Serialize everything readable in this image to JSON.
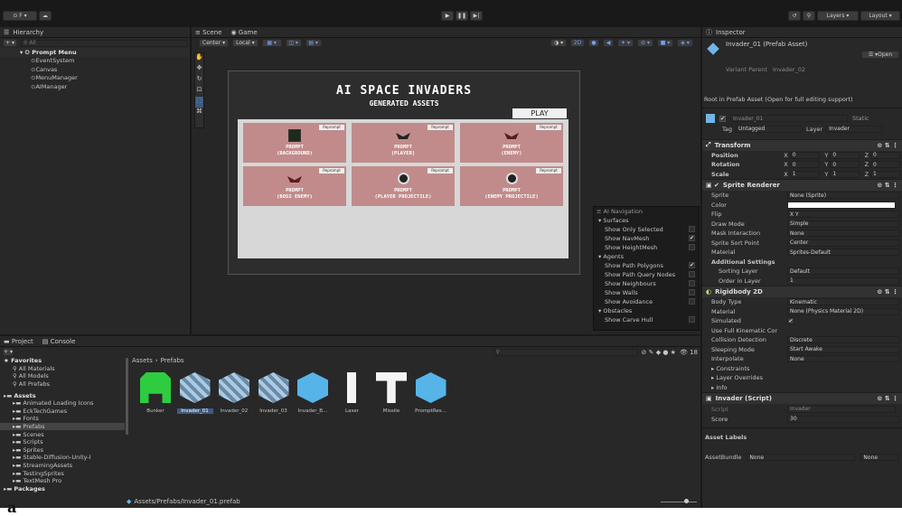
{
  "toolbar": {
    "account_label": "⊙ F ▾",
    "play": "▶",
    "pause": "❚❚",
    "step": "▶|",
    "search": "⚲",
    "layers": "Layers",
    "layout": "Layout"
  },
  "hierarchy": {
    "tab": "Hierarchy",
    "add": "+ ▾",
    "search_placeholder": "All",
    "root": "Prompt Menu",
    "children": [
      "EventSystem",
      "Canvas",
      "MenuManager",
      "AIManager"
    ]
  },
  "scene": {
    "tabs": [
      "Scene",
      "Game"
    ],
    "pivot": "Center ▾",
    "space": "Local ▾",
    "mode2d": "2D"
  },
  "game": {
    "title": "AI SPACE INVADERS",
    "subtitle": "GENERATED ASSETS",
    "play": "PLAY",
    "reprompt": "Reprompt",
    "cards": [
      {
        "line1": "PROMPT",
        "line2": "(BACKGROUND)",
        "icon": "background-thumb"
      },
      {
        "line1": "PROMPT",
        "line2": "(PLAYER)",
        "icon": "player-ship"
      },
      {
        "line1": "PROMPT",
        "line2": "(ENEMY)",
        "icon": "enemy-ship"
      },
      {
        "line1": "PROMPT",
        "line2": "(BOSS ENEMY)",
        "icon": "boss-ship"
      },
      {
        "line1": "PROMPT",
        "line2": "(PLAYER PROJECTILE)",
        "icon": "player-projectile"
      },
      {
        "line1": "PROMPT",
        "line2": "(ENEMY PROJECTILE)",
        "icon": "enemy-projectile"
      }
    ]
  },
  "ainav": {
    "title": "AI Navigation",
    "items": [
      {
        "label": "▾ Surfaces",
        "kind": "header"
      },
      {
        "label": "Show Only Selected",
        "kind": "check",
        "checked": false
      },
      {
        "label": "Show NavMesh",
        "kind": "check",
        "checked": true
      },
      {
        "label": "Show HeightMesh",
        "kind": "check",
        "checked": false
      },
      {
        "label": "▾ Agents",
        "kind": "header"
      },
      {
        "label": "Show Path Polygons",
        "kind": "check",
        "checked": true
      },
      {
        "label": "Show Path Query Nodes",
        "kind": "check",
        "checked": false
      },
      {
        "label": "Show Neighbours",
        "kind": "check",
        "checked": false
      },
      {
        "label": "Show Walls",
        "kind": "check",
        "checked": false
      },
      {
        "label": "Show Avoidance",
        "kind": "check",
        "checked": false
      },
      {
        "label": "▾ Obstacles",
        "kind": "header"
      },
      {
        "label": "Show Carve Hull",
        "kind": "check",
        "checked": false
      }
    ]
  },
  "project": {
    "tabs": [
      "Project",
      "Console"
    ],
    "breadcrumb": [
      "Assets",
      "Prefabs"
    ],
    "count": "18",
    "tree": [
      {
        "label": "★ Favorites",
        "indent": 0,
        "bold": true
      },
      {
        "label": "All Materials",
        "indent": 1,
        "search": true
      },
      {
        "label": "All Models",
        "indent": 1,
        "search": true
      },
      {
        "label": "All Prefabs",
        "indent": 1,
        "search": true
      },
      {
        "label": "",
        "indent": 0,
        "gap": true
      },
      {
        "label": "Assets",
        "indent": 0,
        "bold": true,
        "folder": true
      },
      {
        "label": "Animated Loading Icons",
        "indent": 1,
        "folder": true
      },
      {
        "label": "EckTechGames",
        "indent": 1,
        "folder": true
      },
      {
        "label": "Fonts",
        "indent": 1,
        "folder": true
      },
      {
        "label": "Prefabs",
        "indent": 1,
        "folder": true,
        "selected": true
      },
      {
        "label": "Scenes",
        "indent": 1,
        "folder": true
      },
      {
        "label": "Scripts",
        "indent": 1,
        "folder": true
      },
      {
        "label": "Sprites",
        "indent": 1,
        "folder": true
      },
      {
        "label": "Stable-Diffusion-Unity-I",
        "indent": 1,
        "folder": true
      },
      {
        "label": "StreamingAssets",
        "indent": 1,
        "folder": true
      },
      {
        "label": "TestingSprites",
        "indent": 1,
        "folder": true
      },
      {
        "label": "TextMesh Pro",
        "indent": 1,
        "folder": true
      },
      {
        "label": "Packages",
        "indent": 0,
        "bold": true,
        "folder": true
      }
    ],
    "assets": [
      {
        "name": "Bunker",
        "kind": "bunker"
      },
      {
        "name": "Invader_01",
        "kind": "striped",
        "selected": true
      },
      {
        "name": "Invader_02",
        "kind": "striped"
      },
      {
        "name": "Invader_03",
        "kind": "striped"
      },
      {
        "name": "Invader_B...",
        "kind": "cube"
      },
      {
        "name": "Laser",
        "kind": "laser"
      },
      {
        "name": "Missile",
        "kind": "tee"
      },
      {
        "name": "PromptRes...",
        "kind": "cube"
      }
    ],
    "status_path": "Assets/Prefabs/Invader_01.prefab"
  },
  "inspector": {
    "tab": "Inspector",
    "asset_name": "Invader_01 (Prefab Asset)",
    "open": "Open",
    "variant_parent": "Variant Parent",
    "variant_value": "Invader_02",
    "root_note": "Root in Prefab Asset (Open for full editing support)",
    "go_name": "Invader_01",
    "static": "Static",
    "tag_label": "Tag",
    "tag_value": "Untagged",
    "layer_label": "Layer",
    "layer_value": "Invader",
    "transform": {
      "title": "Transform",
      "rows": [
        {
          "label": "Position",
          "x": "0",
          "y": "0",
          "z": "0"
        },
        {
          "label": "Rotation",
          "x": "0",
          "y": "0",
          "z": "0"
        },
        {
          "label": "Scale",
          "x": "1",
          "y": "1",
          "z": "1"
        }
      ]
    },
    "sprite_renderer": {
      "title": "Sprite Renderer",
      "rows": [
        {
          "label": "Sprite",
          "value": "None (Sprite)"
        },
        {
          "label": "Color",
          "value": ""
        },
        {
          "label": "Flip",
          "value": "X   Y"
        },
        {
          "label": "Draw Mode",
          "value": "Simple"
        },
        {
          "label": "Mask Interaction",
          "value": "None"
        },
        {
          "label": "Sprite Sort Point",
          "value": "Center"
        },
        {
          "label": "Material",
          "value": "Sprites-Default"
        },
        {
          "label": "Additional Settings",
          "value": ""
        },
        {
          "label": "Sorting Layer",
          "value": "Default"
        },
        {
          "label": "Order in Layer",
          "value": "1"
        }
      ]
    },
    "rigidbody": {
      "title": "Rigidbody 2D",
      "rows": [
        {
          "label": "Body Type",
          "value": "Kinematic"
        },
        {
          "label": "Material",
          "value": "None (Physics Material 2D)"
        },
        {
          "label": "Simulated",
          "value": "✔"
        },
        {
          "label": "Use Full Kinematic Cor",
          "value": ""
        },
        {
          "label": "Collision Detection",
          "value": "Discrete"
        },
        {
          "label": "Sleeping Mode",
          "value": "Start Awake"
        },
        {
          "label": "Interpolate",
          "value": "None"
        },
        {
          "label": "▸ Constraints",
          "value": ""
        },
        {
          "label": "▸ Layer Overrides",
          "value": ""
        },
        {
          "label": "▸ Info",
          "value": ""
        }
      ]
    },
    "script": {
      "title": "Invader (Script)",
      "script_label": "Script",
      "script_value": "Invader",
      "score_label": "Score",
      "score_value": "30"
    },
    "asset_labels": "Asset Labels",
    "asset_bundle": "AssetBundle",
    "bundle_value": "None",
    "bundle_variant": "None"
  },
  "caption": "a"
}
